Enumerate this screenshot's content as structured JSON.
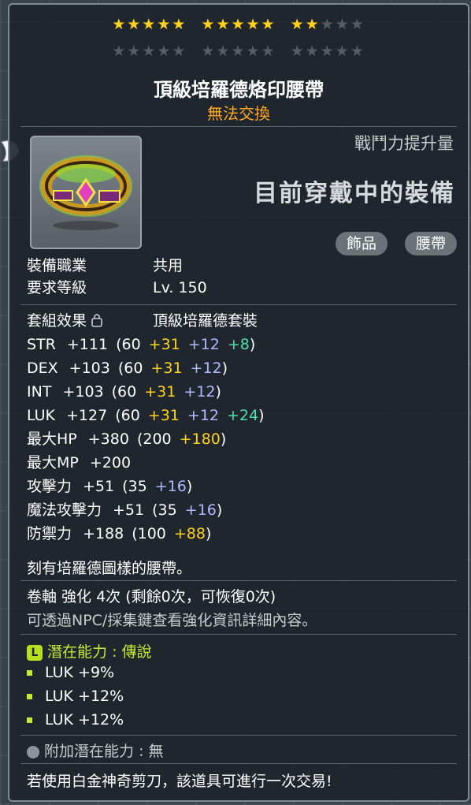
{
  "stars": {
    "row1": [
      {
        "filled": 5
      },
      {
        "filled": 5
      },
      {
        "filled": 2,
        "empty": 3
      }
    ],
    "row2_empty_groups": 3,
    "star_glyph": "★",
    "filled_color": "#ffd21c",
    "empty_color": "#555c62"
  },
  "item": {
    "name": "頂級培羅德烙印腰帶",
    "trade_status": "無法交換",
    "icon_name": "belt-icon"
  },
  "header_right": {
    "cp_label": "戰鬥力提升量",
    "equipped": "目前穿戴中的裝備",
    "tags": [
      "飾品",
      "腰帶"
    ]
  },
  "requirements": [
    {
      "label": "裝備職業",
      "value": "共用"
    },
    {
      "label": "要求等級",
      "value": "Lv. 150"
    }
  ],
  "set": {
    "label": "套組效果",
    "value": "頂級培羅德套裝",
    "lock_icon": "lock-icon"
  },
  "stats": [
    {
      "name": "STR",
      "total": "+111",
      "base": "(60",
      "parts": [
        [
          "+31",
          "g"
        ],
        [
          "+12",
          "b"
        ],
        [
          "+8",
          "t"
        ]
      ],
      "close": ")"
    },
    {
      "name": "DEX",
      "total": "+103",
      "base": "(60",
      "parts": [
        [
          "+31",
          "g"
        ],
        [
          "+12",
          "b"
        ]
      ],
      "close": ")"
    },
    {
      "name": "INT",
      "total": "+103",
      "base": "(60",
      "parts": [
        [
          "+31",
          "g"
        ],
        [
          "+12",
          "b"
        ]
      ],
      "close": ")"
    },
    {
      "name": "LUK",
      "total": "+127",
      "base": "(60",
      "parts": [
        [
          "+31",
          "g"
        ],
        [
          "+12",
          "b"
        ],
        [
          "+24",
          "t"
        ]
      ],
      "close": ")"
    },
    {
      "name": "最大HP",
      "total": "+380",
      "base": "(200",
      "parts": [
        [
          "+180",
          "g"
        ]
      ],
      "close": ")"
    },
    {
      "name": "最大MP",
      "total": "+200",
      "base": "",
      "parts": [],
      "close": ""
    },
    {
      "name": "攻擊力",
      "total": "+51",
      "base": "(35",
      "parts": [
        [
          "+16",
          "b"
        ]
      ],
      "close": ")"
    },
    {
      "name": "魔法攻擊力",
      "total": "+51",
      "base": "(35",
      "parts": [
        [
          "+16",
          "b"
        ]
      ],
      "close": ")"
    },
    {
      "name": "防禦力",
      "total": "+188",
      "base": "(100",
      "parts": [
        [
          "+88",
          "g"
        ]
      ],
      "close": ")"
    }
  ],
  "description": "刻有培羅德圖樣的腰帶。",
  "scroll_info": "卷軸 強化 4次 (剩餘0次，可恢復0次)",
  "npc_hint": "可透過NPC/採集鍵查看強化資訊詳細內容。",
  "potential": {
    "icon_letter": "L",
    "label": "潛在能力 : 傳說",
    "lines": [
      "LUK +9%",
      "LUK +12%",
      "LUK +12%"
    ]
  },
  "additional_potential": {
    "label": "附加潛在能力 : 無"
  },
  "footer": "若使用白金神奇剪刀，該道具可進行一次交易!"
}
